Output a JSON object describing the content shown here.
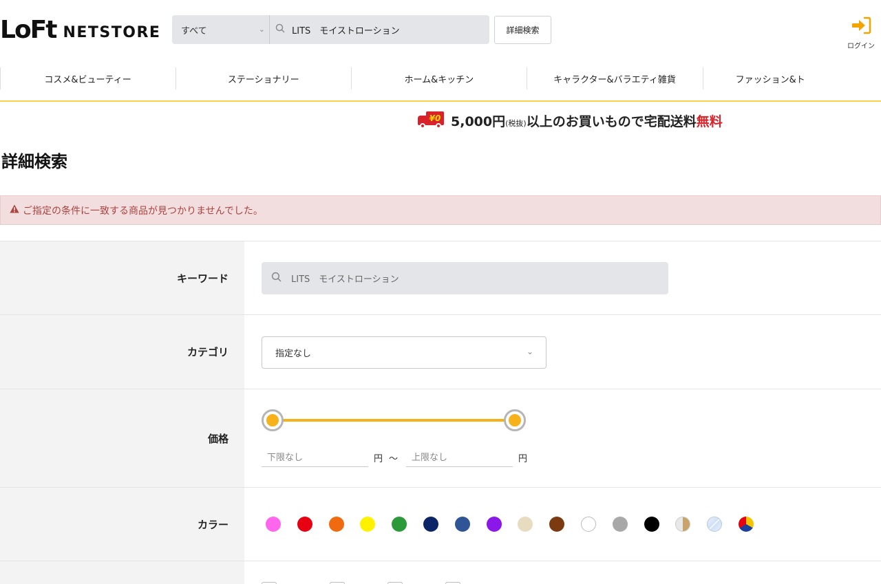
{
  "header": {
    "logo_main": "LoFt",
    "logo_sub": "NETSTORE",
    "search_scope": "すべて",
    "search_query": "LITS　モイストローション",
    "advanced_search_label": "詳細検索",
    "login_label": "ログイン"
  },
  "nav": {
    "items": [
      {
        "label": "コスメ&ビューティー"
      },
      {
        "label": "ステーショナリー"
      },
      {
        "label": "ホーム&キッチン"
      },
      {
        "label": "キャラクター&バラエティ雑貨"
      },
      {
        "label": "ファッション&ト"
      }
    ]
  },
  "banner": {
    "truck_label": "¥0",
    "amount": "5,000円",
    "tax_note": "(税抜)",
    "text": "以上のお買いもので宅配送料",
    "free": "無料"
  },
  "page": {
    "title": "詳細検索",
    "alert": "ご指定の条件に一致する商品が見つかりませんでした。"
  },
  "form": {
    "keyword": {
      "label": "キーワード",
      "value": "LITS　モイストローション"
    },
    "category": {
      "label": "カテゴリ",
      "value": "指定なし"
    },
    "price": {
      "label": "価格",
      "min_placeholder": "下限なし",
      "max_placeholder": "上限なし",
      "unit": "円",
      "separator": "～"
    },
    "color": {
      "label": "カラー",
      "swatches": [
        {
          "name": "pink",
          "color": "#ff66ee"
        },
        {
          "name": "red",
          "color": "#e60012"
        },
        {
          "name": "orange",
          "color": "#f06a0f"
        },
        {
          "name": "yellow",
          "color": "#fff200"
        },
        {
          "name": "green",
          "color": "#2a9a3a"
        },
        {
          "name": "navy",
          "color": "#0b2566"
        },
        {
          "name": "blue",
          "color": "#2f5596"
        },
        {
          "name": "purple",
          "color": "#8b17e8"
        },
        {
          "name": "beige",
          "color": "#e7dbc0"
        },
        {
          "name": "brown",
          "color": "#7b3a10"
        },
        {
          "name": "white",
          "color": "#ffffff"
        },
        {
          "name": "gray",
          "color": "#a8a8a8"
        },
        {
          "name": "black",
          "color": "#000000"
        },
        {
          "name": "gold",
          "color": "#c9a46a"
        },
        {
          "name": "clear",
          "color": "#cfe0f6"
        },
        {
          "name": "multi",
          "color": "#e60012"
        }
      ]
    }
  },
  "colors": {
    "accent_yellow": "#f5b21a",
    "alert_bg": "#f2dede",
    "alert_text": "#a94442",
    "free_red": "#d8232a"
  }
}
